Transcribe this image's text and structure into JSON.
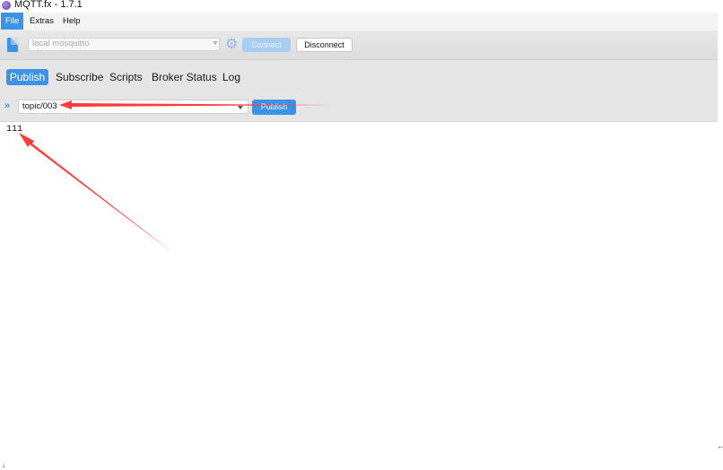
{
  "window": {
    "title": "MQTT.fx - 1.7.1"
  },
  "menu": {
    "file": "File",
    "extras": "Extras",
    "help": "Help"
  },
  "connection": {
    "profile": "local mosquitto",
    "connect_label": "Connect",
    "disconnect_label": "Disconnect"
  },
  "tabs": [
    {
      "label": "Publish",
      "active": true
    },
    {
      "label": "Subscribe",
      "active": false
    },
    {
      "label": "Scripts",
      "active": false
    },
    {
      "label": "Broker Status",
      "active": false
    },
    {
      "label": "Log",
      "active": false
    }
  ],
  "publish": {
    "topic": "topic/003",
    "button_label": "Publish",
    "payload": "111"
  },
  "marks": {
    "right": "←",
    "left": "↓"
  },
  "colors": {
    "accent": "#3a93e6",
    "annotation": "#ff3a3a"
  }
}
